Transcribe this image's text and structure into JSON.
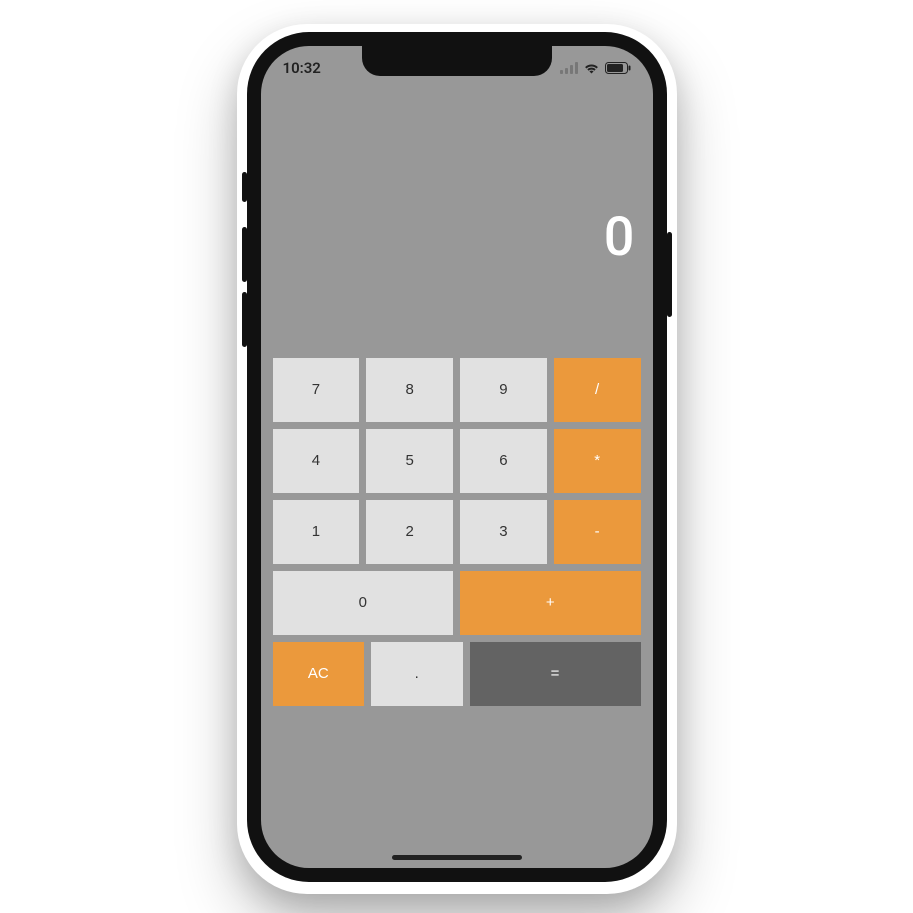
{
  "status": {
    "time": "10:32"
  },
  "display": {
    "value": "0"
  },
  "keys": {
    "n7": "7",
    "n8": "8",
    "n9": "9",
    "div": "/",
    "n4": "4",
    "n5": "5",
    "n6": "6",
    "mul": "*",
    "n1": "1",
    "n2": "2",
    "n3": "3",
    "sub": "-",
    "n0": "0",
    "add": "+",
    "ac": "AC",
    "dot": ".",
    "eq": "="
  }
}
